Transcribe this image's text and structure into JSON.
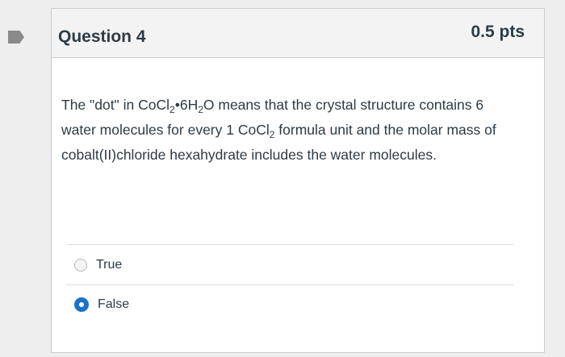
{
  "question": {
    "title": "Question 4",
    "points": "0.5 pts",
    "text_parts": {
      "p1": "The \"dot\" in CoCl",
      "s1": "2",
      "p2": "•6H",
      "s2": "2",
      "p3": "O means that the crystal structure contains 6 water molecules for every 1 CoCl",
      "s3": "2",
      "p4": " formula unit and the molar mass of cobalt(II)chloride hexahydrate includes the water molecules."
    },
    "answers": [
      {
        "label": "True",
        "selected": false
      },
      {
        "label": "False",
        "selected": true
      }
    ]
  },
  "colors": {
    "selected_radio": "#1a73c8",
    "marker": "#8a8a8a"
  },
  "icons": {
    "marker": "question-flag-marker-icon"
  }
}
